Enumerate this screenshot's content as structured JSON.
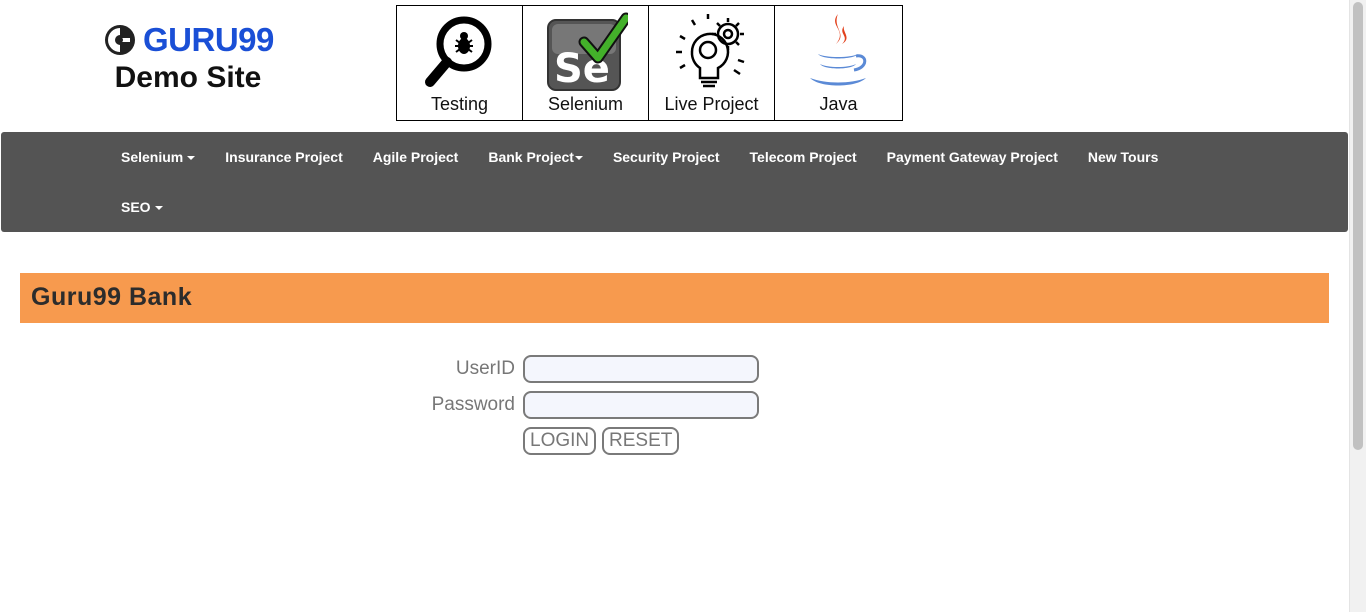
{
  "logo": {
    "brand": "GURU99",
    "subtitle": "Demo Site"
  },
  "tiles": [
    {
      "label": "Testing",
      "icon": "magnifier-bug-icon"
    },
    {
      "label": "Selenium",
      "icon": "selenium-icon"
    },
    {
      "label": "Live Project",
      "icon": "lightbulb-gear-icon"
    },
    {
      "label": "Java",
      "icon": "java-cup-icon"
    }
  ],
  "nav": {
    "row1": [
      "Selenium",
      "Insurance Project",
      "Agile Project",
      "Bank Project",
      "Security Project",
      "Telecom Project",
      "Payment Gateway Project",
      "New Tours"
    ],
    "row2": [
      "SEO"
    ]
  },
  "banner": {
    "title": "Guru99 Bank"
  },
  "form": {
    "userid_label": "UserID",
    "userid_value": "",
    "password_label": "Password",
    "password_value": "",
    "login_label": "LOGIN",
    "reset_label": "RESET"
  },
  "colors": {
    "brand_blue": "#1a4fd6",
    "navbar": "#545454",
    "banner": "#f79a4e"
  }
}
